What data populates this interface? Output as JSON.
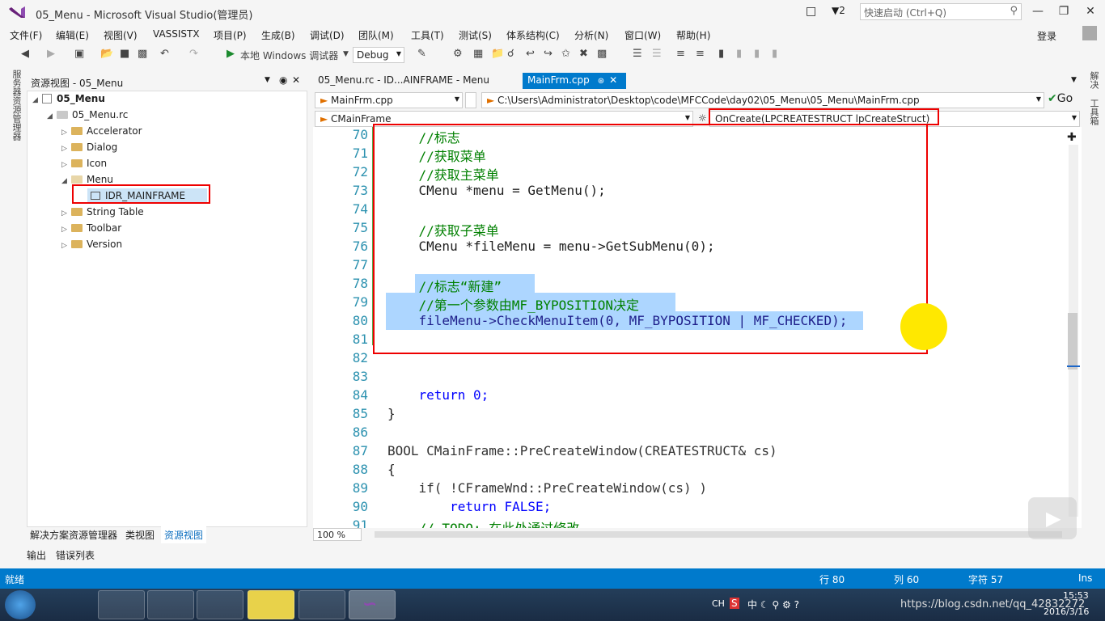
{
  "window": {
    "title": "05_Menu - Microsoft Visual Studio(管理员)",
    "notifications": "2",
    "quick_launch_placeholder": "快速启动 (Ctrl+Q)",
    "login": "登录"
  },
  "menu": [
    "文件(F)",
    "编辑(E)",
    "视图(V)",
    "VASSISTX",
    "项目(P)",
    "生成(B)",
    "调试(D)",
    "团队(M)",
    "工具(T)",
    "测试(S)",
    "体系结构(C)",
    "分析(N)",
    "窗口(W)",
    "帮助(H)"
  ],
  "toolbar": {
    "run_label": "本地 Windows 调试器",
    "config": "Debug"
  },
  "left_strip": "服务器资源管理器",
  "resource_view": {
    "title": "资源视图 - 05_Menu",
    "tree": {
      "root": "05_Menu",
      "rc": "05_Menu.rc",
      "folders": [
        "Accelerator",
        "Dialog",
        "Icon",
        "Menu",
        "String Table",
        "Toolbar",
        "Version"
      ],
      "selected_child": "IDR_MAINFRAME"
    }
  },
  "panel_tabs": [
    "解决方案资源管理器",
    "类视图",
    "资源视图"
  ],
  "output_tabs": [
    "输出",
    "错误列表"
  ],
  "editor": {
    "tabs": [
      "05_Menu.rc - ID...AINFRAME - Menu",
      "MainFrm.cpp"
    ],
    "nav": {
      "file": "MainFrm.cpp",
      "path": "C:\\Users\\Administrator\\Desktop\\code\\MFCCode\\day02\\05_Menu\\05_Menu\\MainFrm.cpp",
      "go": "Go",
      "class": "CMainFrame",
      "member": "OnCreate(LPCREATESTRUCT lpCreateStruct)"
    },
    "zoom": "100 %",
    "lines": [
      {
        "n": "70",
        "t": "    //标志"
      },
      {
        "n": "71",
        "t": "    //获取菜单"
      },
      {
        "n": "72",
        "t": "    //获取主菜单"
      },
      {
        "n": "73",
        "t": "    CMenu *menu = GetMenu();"
      },
      {
        "n": "74",
        "t": ""
      },
      {
        "n": "75",
        "t": "    //获取子菜单"
      },
      {
        "n": "76",
        "t": "    CMenu *fileMenu = menu->GetSubMenu(0);"
      },
      {
        "n": "77",
        "t": ""
      },
      {
        "n": "78",
        "t": "    //标志“新建”"
      },
      {
        "n": "79",
        "t": "    //第一个参数由MF_BYPOSITION决定"
      },
      {
        "n": "80",
        "t": "    fileMenu->CheckMenuItem(0, MF_BYPOSITION | MF_CHECKED);"
      },
      {
        "n": "81",
        "t": ""
      },
      {
        "n": "82",
        "t": ""
      },
      {
        "n": "83",
        "t": ""
      },
      {
        "n": "84",
        "t": "    return 0;"
      },
      {
        "n": "85",
        "t": "}"
      },
      {
        "n": "86",
        "t": ""
      },
      {
        "n": "87",
        "t": "BOOL CMainFrame::PreCreateWindow(CREATESTRUCT& cs)"
      },
      {
        "n": "88",
        "t": "{"
      },
      {
        "n": "89",
        "t": "    if( !CFrameWnd::PreCreateWindow(cs) )"
      },
      {
        "n": "90",
        "t": "        return FALSE;"
      },
      {
        "n": "91",
        "t": "    // TODO: 在此处通过修改"
      }
    ]
  },
  "right_strip": [
    "解决",
    "工具箱"
  ],
  "status": {
    "ready": "就绪",
    "line": "行 80",
    "col": "列 60",
    "char": "字符 57",
    "mode": "Ins"
  },
  "taskbar": {
    "ime": "CH",
    "time": "15:53",
    "date": "2016/3/16",
    "watermark": "https://blog.csdn.net/qq_42832272"
  }
}
